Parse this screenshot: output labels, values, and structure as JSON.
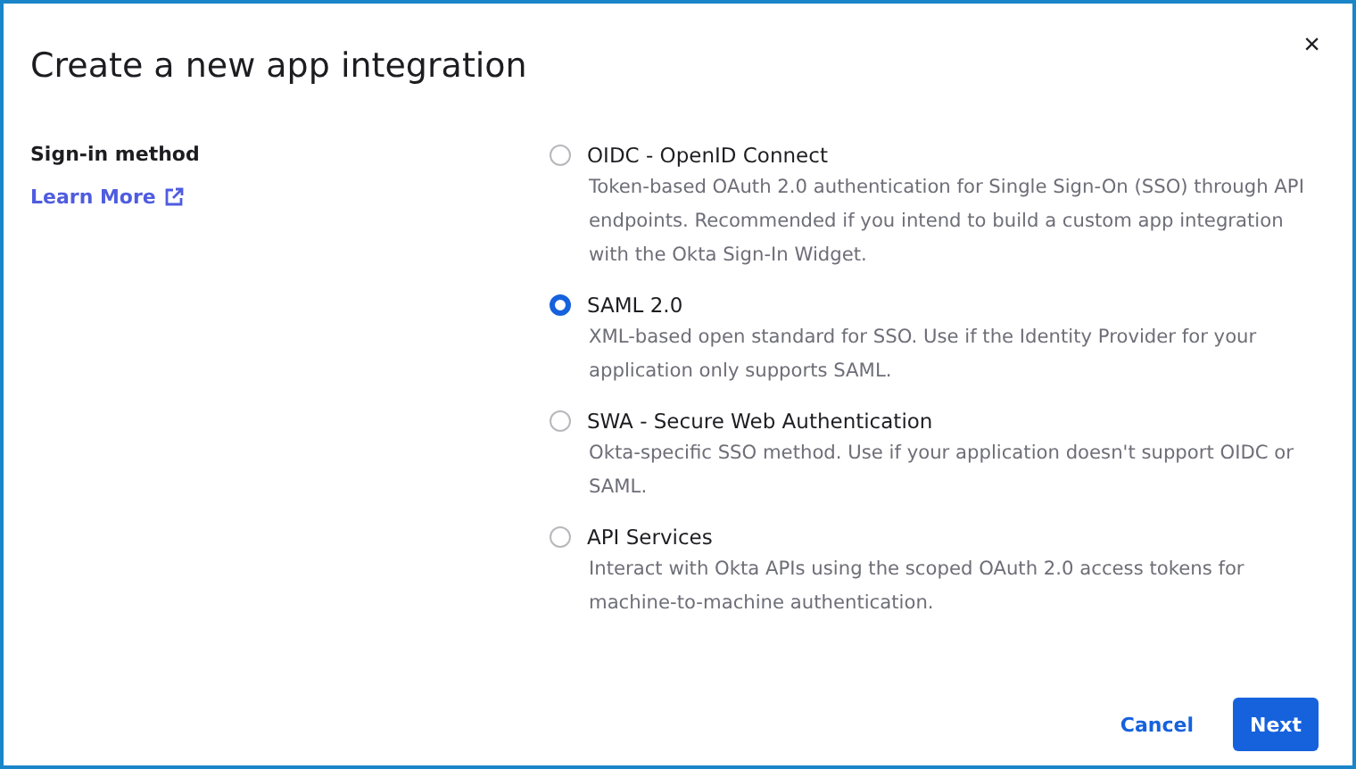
{
  "dialog": {
    "title": "Create a new app integration",
    "close": "×"
  },
  "section_label": "Sign-in method",
  "learn_more": "Learn More",
  "options": [
    {
      "label": "OIDC - OpenID Connect",
      "description": "Token-based OAuth 2.0 authentication for Single Sign-On (SSO) through API endpoints. Recommended if you intend to build a custom app integration with the Okta Sign-In Widget.",
      "selected": false
    },
    {
      "label": "SAML 2.0",
      "description": "XML-based open standard for SSO. Use if the Identity Provider for your application only supports SAML.",
      "selected": true
    },
    {
      "label": "SWA - Secure Web Authentication",
      "description": "Okta-specific SSO method. Use if your application doesn't support OIDC or SAML.",
      "selected": false
    },
    {
      "label": "API Services",
      "description": "Interact with Okta APIs using the scoped OAuth 2.0 access tokens for machine-to-machine authentication.",
      "selected": false
    }
  ],
  "buttons": {
    "cancel": "Cancel",
    "next": "Next"
  }
}
